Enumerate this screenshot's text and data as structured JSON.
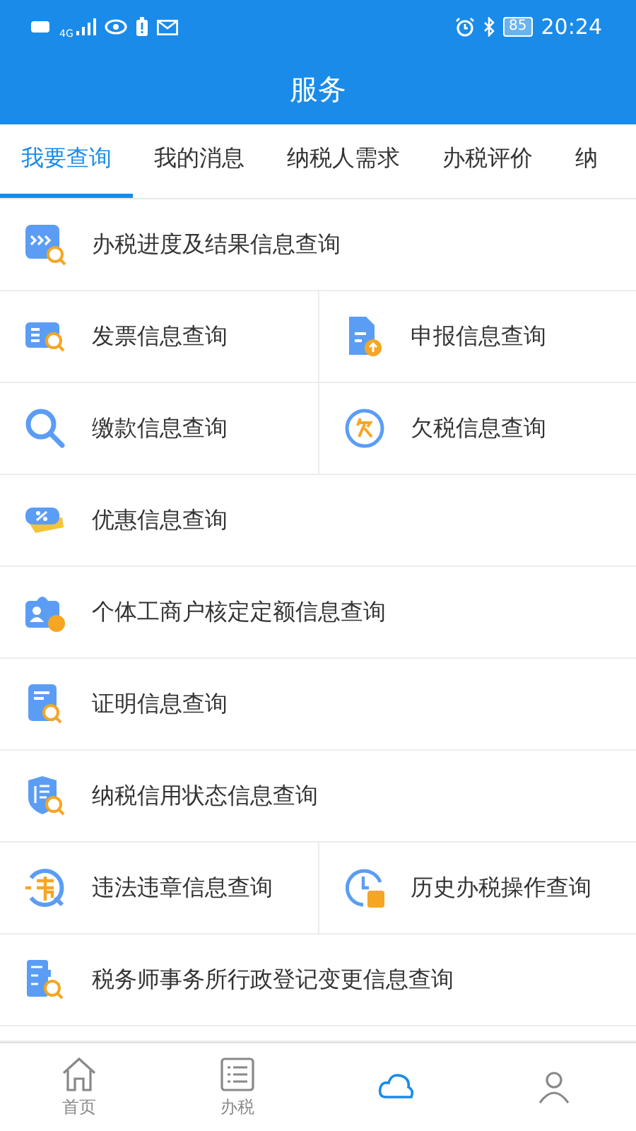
{
  "status_bar": {
    "network": "4G",
    "battery": "85",
    "time": "20:24"
  },
  "header": {
    "title": "服务"
  },
  "tabs": [
    {
      "label": "我要查询",
      "selected": true
    },
    {
      "label": "我的消息",
      "selected": false
    },
    {
      "label": "纳税人需求",
      "selected": false
    },
    {
      "label": "办税评价",
      "selected": false
    },
    {
      "label": "纳",
      "selected": false
    }
  ],
  "rows": [
    {
      "cells": [
        {
          "kind": "progress",
          "label": "办税进度及结果信息查询"
        }
      ]
    },
    {
      "cells": [
        {
          "kind": "invoice",
          "label": "发票信息查询"
        },
        {
          "kind": "declare",
          "label": "申报信息查询"
        }
      ]
    },
    {
      "cells": [
        {
          "kind": "payment",
          "label": "缴款信息查询"
        },
        {
          "kind": "arrears",
          "label": "欠税信息查询"
        }
      ]
    },
    {
      "cells": [
        {
          "kind": "discount",
          "label": "优惠信息查询"
        }
      ]
    },
    {
      "cells": [
        {
          "kind": "individual",
          "label": "个体工商户核定定额信息查询"
        }
      ]
    },
    {
      "cells": [
        {
          "kind": "certificate",
          "label": "证明信息查询"
        }
      ]
    },
    {
      "cells": [
        {
          "kind": "credit",
          "label": "纳税信用状态信息查询"
        }
      ]
    },
    {
      "cells": [
        {
          "kind": "violation",
          "label": "违法违章信息查询"
        },
        {
          "kind": "history",
          "label": "历史办税操作查询"
        }
      ]
    },
    {
      "cells": [
        {
          "kind": "agent",
          "label": "税务师事务所行政登记变更信息查询"
        }
      ]
    }
  ],
  "bottom_nav": [
    {
      "kind": "home",
      "label": "首页",
      "selected": false
    },
    {
      "kind": "list",
      "label": "办税",
      "selected": false
    },
    {
      "kind": "service",
      "selected": true
    },
    {
      "kind": "user",
      "selected": false
    }
  ]
}
